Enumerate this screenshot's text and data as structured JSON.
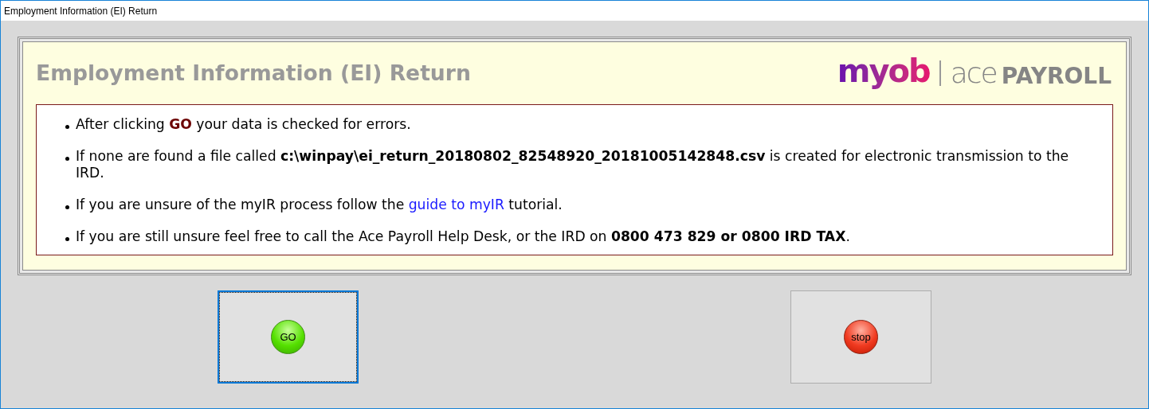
{
  "window": {
    "title": "Employment Information (EI) Return"
  },
  "heading": "Employment Information (EI) Return",
  "logo": {
    "brand": "myob",
    "product_light": "ace",
    "product_bold": "PAYROLL"
  },
  "instructions": [
    {
      "text": "After clicking **GO** your data is checked for errors.",
      "kind": "action"
    },
    {
      "text": "If none are found a file called **c:\\winpay\\ei_return_20180802_82548920_20181005142848.csv** is created for electronic transmission to the IRD."
    },
    {
      "text": "If you are unsure of the myIR process follow the ",
      "link": "guide to myIR",
      "text_after": " tutorial."
    },
    {
      "text": "If you are still unsure feel free to call the Ace Payroll Help Desk, or the IRD on **0800 473 829 or 0800 IRD TAX**."
    }
  ],
  "buttons": [
    {
      "label": "GO",
      "kind": "go",
      "focused": true
    },
    {
      "label": "stop",
      "kind": "stop",
      "focused": false
    }
  ]
}
